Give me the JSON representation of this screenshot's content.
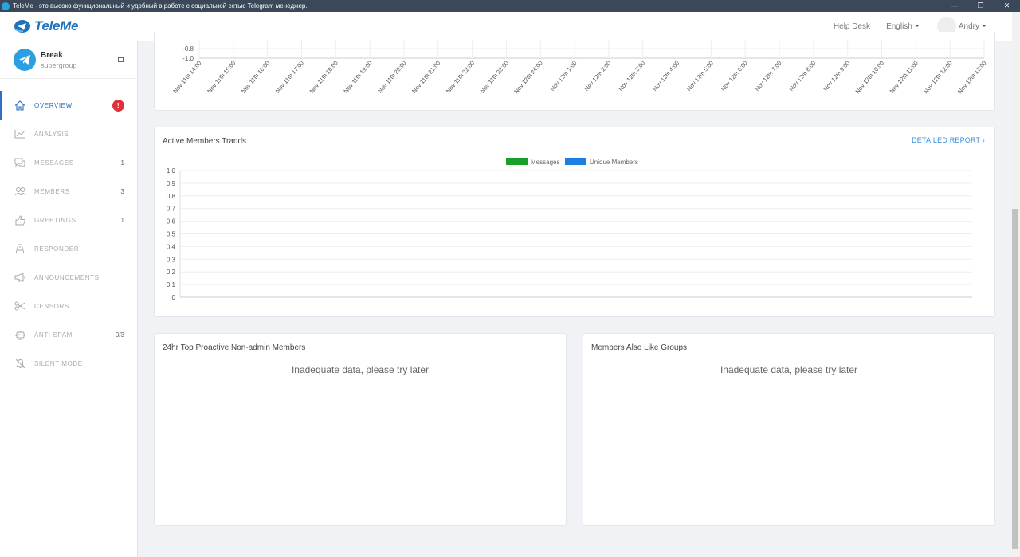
{
  "window": {
    "title": "TeleMe - это высоко функциональный и удобный в работе с социальной сетью Telegram менеджер.",
    "minimize": "—",
    "maximize": "❐",
    "close": "✕"
  },
  "header": {
    "logo_text": "TeleMe",
    "help_desk": "Help Desk",
    "language": "English",
    "user": "Andry"
  },
  "group": {
    "name": "Break",
    "type": "supergroup"
  },
  "sidebar": {
    "items": [
      {
        "key": "overview",
        "label": "OVERVIEW",
        "badge": "!",
        "icon": "home-icon",
        "active": true
      },
      {
        "key": "analysis",
        "label": "ANALYSIS",
        "count": "",
        "icon": "chart-icon"
      },
      {
        "key": "messages",
        "label": "MESSAGES",
        "count": "1",
        "icon": "chat-icon"
      },
      {
        "key": "members",
        "label": "MEMBERS",
        "count": "3",
        "icon": "users-icon"
      },
      {
        "key": "greetings",
        "label": "GREETINGS",
        "count": "1",
        "icon": "thumbs-up-icon"
      },
      {
        "key": "responder",
        "label": "RESPONDER",
        "count": "",
        "icon": "responder-icon"
      },
      {
        "key": "announcements",
        "label": "ANNOUNCEMENTS",
        "count": "",
        "icon": "megaphone-icon"
      },
      {
        "key": "censors",
        "label": "CENSORS",
        "count": "",
        "icon": "scissors-icon"
      },
      {
        "key": "antispam",
        "label": "ANTI SPAM",
        "count": "0/3",
        "icon": "robot-icon"
      },
      {
        "key": "silent",
        "label": "SILENT MODE",
        "count": "",
        "icon": "mute-icon"
      }
    ]
  },
  "top_chart": {
    "y_ticks": [
      "-0.8",
      "-1.0"
    ],
    "x_labels": [
      "Nov 11th 14:00",
      "Nov 11th 15:00",
      "Nov 11th 16:00",
      "Nov 11th 17:00",
      "Nov 11th 18:00",
      "Nov 11th 19:00",
      "Nov 11th 20:00",
      "Nov 11th 21:00",
      "Nov 11th 22:00",
      "Nov 11th 23:00",
      "Nov 12th 24:00",
      "Nov 12th 1:00",
      "Nov 12th 2:00",
      "Nov 12th 3:00",
      "Nov 12th 4:00",
      "Nov 12th 5:00",
      "Nov 12th 6:00",
      "Nov 12th 7:00",
      "Nov 12th 8:00",
      "Nov 12th 9:00",
      "Nov 12th 10:00",
      "Nov 12th 11:00",
      "Nov 12th 12:00",
      "Nov 12th 13:00"
    ]
  },
  "active_members": {
    "title": "Active Members Trands",
    "detail": "DETAILED REPORT",
    "legend": [
      {
        "name": "Messages",
        "color": "#1a9e2c"
      },
      {
        "name": "Unique Members",
        "color": "#1f7fe0"
      }
    ]
  },
  "chart_data": {
    "type": "bar",
    "title": "Active Members Trands",
    "series": [
      {
        "name": "Messages",
        "values": []
      },
      {
        "name": "Unique Members",
        "values": []
      }
    ],
    "y_ticks": [
      "1.0",
      "0.9",
      "0.8",
      "0.7",
      "0.6",
      "0.5",
      "0.4",
      "0.3",
      "0.2",
      "0.1",
      "0"
    ],
    "ylim": [
      0,
      1.0
    ],
    "grid": true,
    "legend": "top-center"
  },
  "proactive": {
    "title": "24hr Top Proactive Non-admin Members",
    "empty": "Inadequate data, please try later"
  },
  "also_like": {
    "title": "Members Also Like Groups",
    "empty": "Inadequate data, please try later"
  },
  "colors": {
    "accent": "#2e6fc2",
    "link": "#3a8fd8",
    "alert": "#e0303a"
  }
}
